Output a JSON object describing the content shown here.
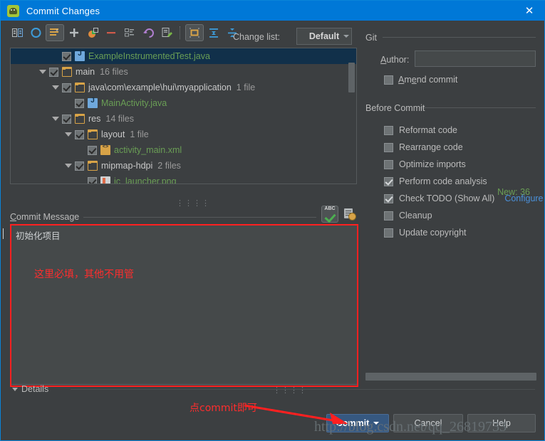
{
  "window": {
    "title": "Commit Changes",
    "app_icon": "android-studio-icon",
    "close_icon": "✕"
  },
  "toolbar": {
    "icons": [
      {
        "name": "show-diff-icon",
        "glyph": "▣"
      },
      {
        "name": "refresh-icon",
        "glyph": "↻"
      },
      {
        "name": "group-by-icon",
        "glyph": "▤"
      },
      {
        "name": "add-icon",
        "glyph": "＋"
      },
      {
        "name": "move-to-changelist-icon",
        "glyph": "◱"
      },
      {
        "name": "delete-icon",
        "glyph": "－"
      },
      {
        "name": "changelist-icon",
        "glyph": "▤"
      },
      {
        "name": "revert-icon",
        "glyph": "↺"
      },
      {
        "name": "edit-source-icon",
        "glyph": "✎"
      },
      {
        "name": "group-by-directory-icon",
        "glyph": "▣"
      },
      {
        "name": "expand-all-icon",
        "glyph": "⇕"
      },
      {
        "name": "collapse-all-icon",
        "glyph": "⇳"
      }
    ],
    "changelist_label": "Change list:",
    "changelist_value": "Default"
  },
  "tree": {
    "rows": [
      {
        "indent": 3,
        "twisty": "none",
        "checked": true,
        "icon": "java-file-icon",
        "name": "ExampleInstrumentedTest.java",
        "count": "",
        "kind": "file",
        "selected": true
      },
      {
        "indent": 2,
        "twisty": "down",
        "checked": true,
        "icon": "folder-icon",
        "name": "main",
        "count": "16 files",
        "kind": "dir",
        "selected": false
      },
      {
        "indent": 3,
        "twisty": "down",
        "checked": true,
        "icon": "folder-icon",
        "name": "java\\com\\example\\hui\\myapplication",
        "count": "1 file",
        "kind": "dir",
        "selected": false
      },
      {
        "indent": 4,
        "twisty": "none",
        "checked": true,
        "icon": "java-file-icon",
        "name": "MainActivity.java",
        "count": "",
        "kind": "file",
        "selected": false
      },
      {
        "indent": 3,
        "twisty": "down",
        "checked": true,
        "icon": "folder-icon",
        "name": "res",
        "count": "14 files",
        "kind": "dir",
        "selected": false
      },
      {
        "indent": 4,
        "twisty": "down",
        "checked": true,
        "icon": "folder-icon",
        "name": "layout",
        "count": "1 file",
        "kind": "dir",
        "selected": false
      },
      {
        "indent": 5,
        "twisty": "none",
        "checked": true,
        "icon": "xml-file-icon",
        "name": "activity_main.xml",
        "count": "",
        "kind": "file",
        "selected": false
      },
      {
        "indent": 4,
        "twisty": "down",
        "checked": true,
        "icon": "folder-icon",
        "name": "mipmap-hdpi",
        "count": "2 files",
        "kind": "dir",
        "selected": false
      },
      {
        "indent": 5,
        "twisty": "none",
        "checked": true,
        "icon": "png-file-icon",
        "name": "ic_launcher.png",
        "count": "",
        "kind": "file",
        "selected": false
      }
    ],
    "new_count_label": "New: 36",
    "grip": "⋮⋮⋮⋮"
  },
  "commit_message": {
    "label": "Commit Message",
    "value": "初始化项目",
    "spell_icon": "spellcheck-icon",
    "spell_icon_text": "ABC",
    "history_icon": "message-history-icon"
  },
  "details": {
    "label": "Details",
    "grip": "⋮⋮⋮⋮"
  },
  "git_panel": {
    "section_title": "Git",
    "author_label": "Author:",
    "author_value": "",
    "amend_label": "Amend commit",
    "amend_checked": false
  },
  "before_commit": {
    "section_title": "Before Commit",
    "items": [
      {
        "label": "Reformat code",
        "checked": false,
        "link": ""
      },
      {
        "label": "Rearrange code",
        "checked": false,
        "link": ""
      },
      {
        "label": "Optimize imports",
        "checked": false,
        "link": ""
      },
      {
        "label": "Perform code analysis",
        "checked": true,
        "link": ""
      },
      {
        "label": "Check TODO (Show All)",
        "checked": true,
        "link": "Configure"
      },
      {
        "label": "Cleanup",
        "checked": false,
        "link": ""
      },
      {
        "label": "Update copyright",
        "checked": false,
        "link": ""
      }
    ]
  },
  "buttons": {
    "commit": "Commit",
    "cancel": "Cancel",
    "help": "Help"
  },
  "annotations": {
    "message_note": "这里必填，其他不用管",
    "commit_note": "点commit即可",
    "watermark": "http://blog.csdn.net/qq_26819733",
    "accent_red": "#ff2020",
    "accent_blue": "#0078d7",
    "link_blue": "#4a90d9",
    "file_green": "#6a9e55"
  }
}
